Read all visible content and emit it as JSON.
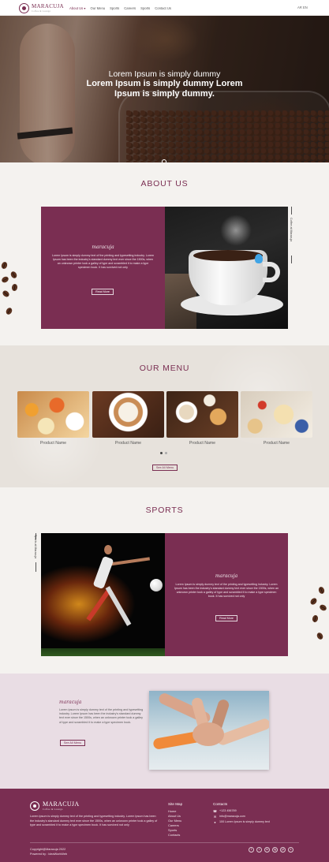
{
  "brand": {
    "name": "MARACUJA",
    "tagline": "Coffee & Lounge"
  },
  "nav": {
    "items": [
      "About Us",
      "Our Menu",
      "Sports",
      "Careers",
      "Sports",
      "Contact Us"
    ],
    "about_caret": "▾",
    "language": "AR EN"
  },
  "hero": {
    "line1": "Lorem Ipsum is simply dummy",
    "line2": "Lorem Ipsum is simply dummy Lorem",
    "line3": "Ipsum is simply dummy."
  },
  "about": {
    "title": "ABOUT US",
    "script": "maracuja",
    "text": "Lorem Ipsum is simply dummy text of the printing and typesetting industry. Lorem Ipsum has been the industry's standard dummy text ever since the 1500s, when an unknown printer took a galley of type and scrambled it to make a type specimen book. It has survived not only",
    "button": "Read More",
    "side_label": "Coffee at Maracuja"
  },
  "menu": {
    "title": "OUR MENU",
    "products": [
      "Product Name",
      "Product Name",
      "Product Name",
      "Product Name"
    ],
    "see_all": "See All Menu"
  },
  "sports": {
    "title": "SPORTS",
    "script": "maracuja",
    "text": "Lorem Ipsum is simply dummy text of the printing and typesetting industry. Lorem Ipsum has been the industry's standard dummy text ever since the 1500s, when an unknown printer took a galley of type and scrambled it to make a type specimen book. It has survived not only",
    "button": "Read More",
    "side_label": "Sports at Maracuja"
  },
  "team": {
    "script": "maracuja",
    "text": "Lorem Ipsum is simply dummy text of the printing and typesetting industry. Lorem Ipsum has been the industry's standard dummy text ever since the 1500s, when an unknown printer took a galley of type and scrambled it to make a type specimen book.",
    "button": "See All Menu"
  },
  "footer": {
    "description": "Lorem Ipsum is simply dummy text of the printing and typesetting industry. Lorem Ipsum has been the industry's standard dummy text ever since the 1500s, when an unknown printer took a galley of type and scrambled it to make a type specimen book. It has survived not only",
    "sitemap_title": "Site Map",
    "sitemap": [
      "Home",
      "About Us",
      "Our Menu",
      "Careers",
      "Sports",
      "Contacts"
    ],
    "contacts_title": "Contacts",
    "phone": "+123 456789",
    "email": "info@maracuja.com",
    "address": "100 Lorem Ipsum is simply dummy text",
    "copyright": "Copyright@Maracuja 2022",
    "powered": "Powered by : IdeaWorkWeb",
    "social": [
      "f",
      "t",
      "in",
      "ig",
      "yt",
      "x"
    ]
  },
  "colors": {
    "brand": "#7a2e52",
    "background": "#f4f2ef",
    "menu_bg": "#e7e2dc",
    "team_bg": "#e9dde4"
  }
}
